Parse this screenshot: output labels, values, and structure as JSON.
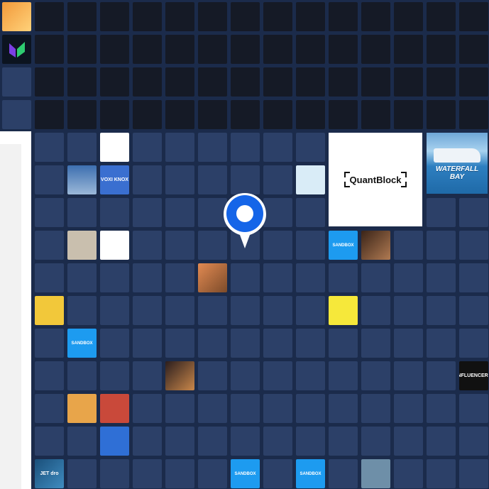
{
  "map": {
    "quantblock_label": "QuantBlock",
    "waterfall_label": "WATERFALL BAY",
    "sandbox_label": "SANDBOX",
    "voxi_label": "VOXI KNOX",
    "jet_label": "JET dro",
    "influencers_label": "INFLUENCERS",
    "colors": {
      "background": "#1b2b4b",
      "cell_dark": "#151a26",
      "cell_blue": "#2c4068",
      "pin_blue": "#1565e8",
      "sandbox_blue": "#1d9bf0"
    }
  },
  "icons": {
    "pin": "location-pin-icon"
  }
}
